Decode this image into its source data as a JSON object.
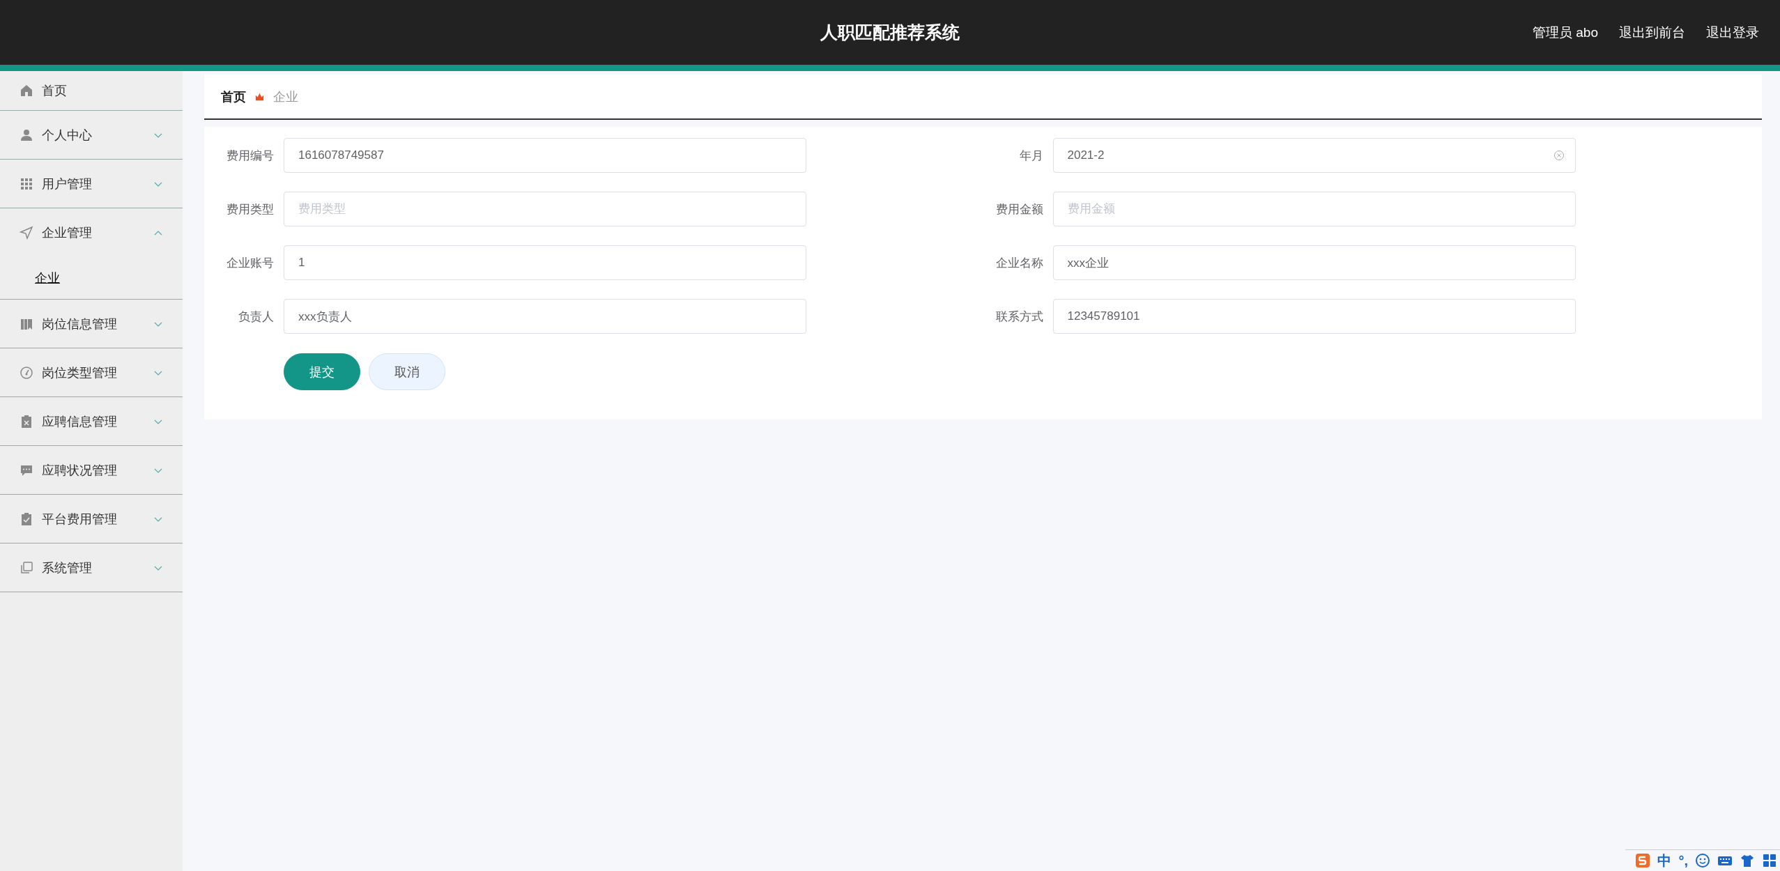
{
  "header": {
    "title": "人职匹配推荐系统",
    "links": [
      "管理员 abo",
      "退出到前台",
      "退出登录"
    ]
  },
  "sidebar": {
    "items": [
      {
        "label": "首页",
        "kind": "link"
      },
      {
        "label": "个人中心",
        "kind": "menu",
        "expanded": false
      },
      {
        "label": "用户管理",
        "kind": "menu",
        "expanded": false
      },
      {
        "label": "企业管理",
        "kind": "menu",
        "expanded": true,
        "children": [
          {
            "label": "企业"
          }
        ]
      },
      {
        "label": "岗位信息管理",
        "kind": "menu",
        "expanded": false
      },
      {
        "label": "岗位类型管理",
        "kind": "menu",
        "expanded": false
      },
      {
        "label": "应聘信息管理",
        "kind": "menu",
        "expanded": false
      },
      {
        "label": "应聘状况管理",
        "kind": "menu",
        "expanded": false
      },
      {
        "label": "平台费用管理",
        "kind": "menu",
        "expanded": false
      },
      {
        "label": "系统管理",
        "kind": "menu",
        "expanded": false
      }
    ]
  },
  "breadcrumb": [
    "首页",
    "企业"
  ],
  "form": {
    "fields": [
      {
        "label": "费用编号",
        "value": "1616078749587"
      },
      {
        "label": "年月",
        "value": "2021-2",
        "clearable": true
      },
      {
        "label": "费用类型",
        "placeholder": "费用类型"
      },
      {
        "label": "费用金额",
        "placeholder": "费用金额"
      },
      {
        "label": "企业账号",
        "value": "1"
      },
      {
        "label": "企业名称",
        "value": "xxx企业"
      },
      {
        "label": "负责人",
        "value": "xxx负责人"
      },
      {
        "label": "联系方式",
        "value": "12345789101"
      }
    ],
    "buttons": [
      {
        "label": "提交",
        "kind": "primary"
      },
      {
        "label": "取消",
        "kind": "plain"
      }
    ]
  },
  "ime_toolbar": {
    "texts": [
      "中",
      "°,"
    ]
  }
}
